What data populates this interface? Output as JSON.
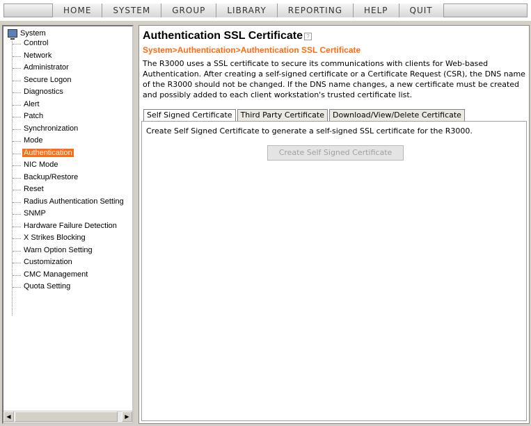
{
  "menu": {
    "items": [
      "HOME",
      "SYSTEM",
      "GROUP",
      "LIBRARY",
      "REPORTING",
      "HELP",
      "QUIT"
    ]
  },
  "sidebar": {
    "root_label": "System",
    "root_icon": "computer-icon",
    "selected_color": "#ff6a13",
    "items": [
      {
        "label": "Control"
      },
      {
        "label": "Network"
      },
      {
        "label": "Administrator"
      },
      {
        "label": "Secure Logon"
      },
      {
        "label": "Diagnostics"
      },
      {
        "label": "Alert"
      },
      {
        "label": "Patch"
      },
      {
        "label": "Synchronization"
      },
      {
        "label": "Mode"
      },
      {
        "label": "Authentication",
        "selected": true
      },
      {
        "label": "NIC Mode"
      },
      {
        "label": "Backup/Restore"
      },
      {
        "label": "Reset"
      },
      {
        "label": "Radius Authentication Setting"
      },
      {
        "label": "SNMP"
      },
      {
        "label": "Hardware Failure Detection"
      },
      {
        "label": "X Strikes Blocking"
      },
      {
        "label": "Warn Option Setting"
      },
      {
        "label": "Customization"
      },
      {
        "label": "CMC Management"
      },
      {
        "label": "Quota Setting"
      }
    ]
  },
  "main": {
    "title": "Authentication SSL Certificate",
    "help_icon": "help-icon",
    "breadcrumb": "System>Authentication>Authentication SSL Certificate",
    "breadcrumb_color": "#ff6a13",
    "description": "The R3000 uses a SSL certificate to secure its communications with clients for Web-based Authentication. After creating a self-signed certificate or a Certificate Request (CSR), the DNS name of the R3000 should not be changed. If the DNS name changes, a new certificate must be created and possibly added to each client workstation's trusted certificate list.",
    "tabs": [
      {
        "label": "Self Signed Certificate",
        "active": true
      },
      {
        "label": "Third Party Certificate"
      },
      {
        "label": "Download/View/Delete Certificate"
      }
    ],
    "panel_text": "Create Self Signed Certificate to generate a self-signed SSL certificate for the R3000.",
    "create_button": "Create Self Signed Certificate"
  }
}
